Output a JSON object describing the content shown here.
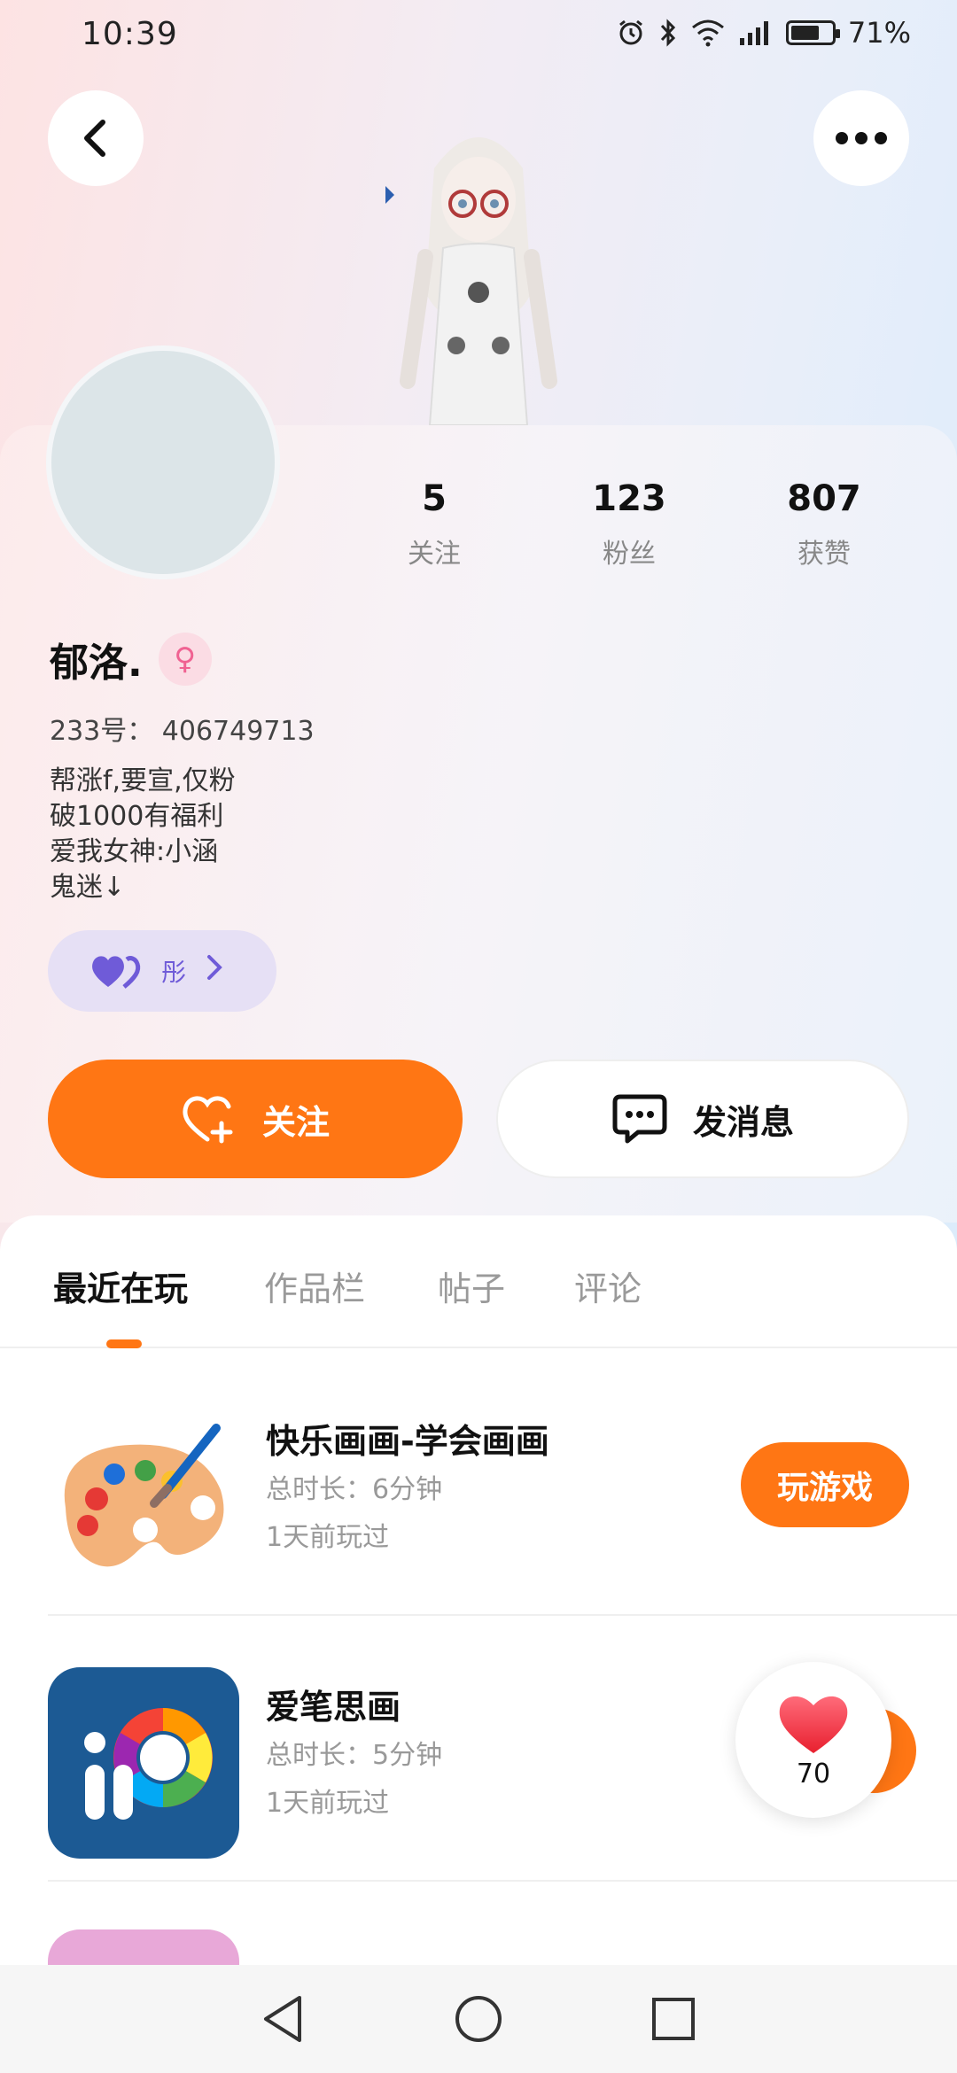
{
  "status_bar": {
    "time": "10:39",
    "battery_percent": "71%",
    "battery_level": 0.71,
    "network": "4G",
    "icons": [
      "alarm-icon",
      "bluetooth-icon",
      "wifi-icon",
      "signal-icon",
      "battery-icon"
    ]
  },
  "header": {
    "back_icon": "chevron-left-icon",
    "more_icon": "more-dots-icon"
  },
  "profile": {
    "stats": [
      {
        "value": "5",
        "label": "关注"
      },
      {
        "value": "123",
        "label": "粉丝"
      },
      {
        "value": "807",
        "label": "获赞"
      }
    ],
    "name": "郁洛.",
    "gender_symbol": "♀",
    "uid": "233号： 406749713",
    "bio": [
      "帮涨f,要宣,仅粉",
      "破1000有福利",
      "爱我女神:小涵",
      "鬼迷↓"
    ],
    "cp_tag": "彤",
    "accent_color": "#ff7614",
    "cp_color": "#6f5bd8"
  },
  "actions": {
    "follow_label": "关注",
    "message_label": "发消息"
  },
  "tabs": [
    {
      "label": "最近在玩",
      "active": true
    },
    {
      "label": "作品栏",
      "active": false
    },
    {
      "label": "帖子",
      "active": false
    },
    {
      "label": "评论",
      "active": false
    }
  ],
  "games": [
    {
      "title": "快乐画画-学会画画",
      "duration": "总时长：6分钟",
      "last_played": "1天前玩过",
      "button": "玩游戏"
    },
    {
      "title": "爱笔思画",
      "duration": "总时长：5分钟",
      "last_played": "1天前玩过"
    }
  ],
  "like_float": {
    "count": "70"
  },
  "nav": [
    "back-triangle-icon",
    "home-circle-icon",
    "recent-square-icon"
  ]
}
